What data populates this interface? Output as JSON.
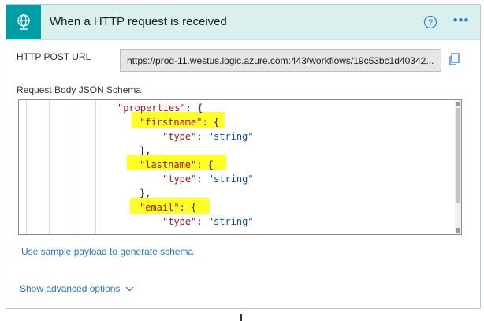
{
  "card": {
    "title": "When a HTTP request is received",
    "icons": {
      "trigger": "globe-network-icon",
      "help": "help-circle-icon",
      "more": "more-options-icon",
      "copy": "copy-icon",
      "chevron": "chevron-down-icon"
    }
  },
  "url": {
    "label": "HTTP POST URL",
    "value": "https://prod-11.westus.logic.azure.com:443/workflows/19c53bc1d40342..."
  },
  "schema": {
    "label": "Request Body JSON Schema",
    "lines": [
      {
        "key": "\"properties\"",
        "rest": ": {"
      },
      {
        "key": "\"firstname\"",
        "rest": ": {"
      },
      {
        "key": "\"type\"",
        "rest": ": ",
        "val": "\"string\""
      },
      {
        "rest": "},"
      },
      {
        "key": "\"lastname\"",
        "rest": ": {"
      },
      {
        "key": "\"type\"",
        "rest": ": ",
        "val": "\"string\""
      },
      {
        "rest": "},"
      },
      {
        "key": "\"email\"",
        "rest": ": {"
      },
      {
        "key": "\"type\"",
        "rest": ": ",
        "val": "\"string\""
      }
    ]
  },
  "links": {
    "sample_payload": "Use sample payload to generate schema",
    "advanced": "Show advanced options"
  },
  "colors": {
    "accent": "#009da5",
    "header_bg": "#d9f0ef",
    "link": "#2573c4",
    "highlight": "#ffff27"
  }
}
